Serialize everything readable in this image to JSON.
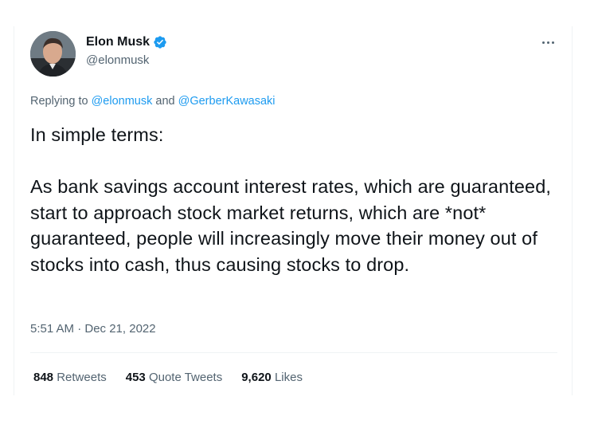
{
  "author": {
    "display_name": "Elon Musk",
    "handle": "@elonmusk",
    "verified": true,
    "verified_color": "#1d9bf0"
  },
  "reply": {
    "prefix": "Replying to ",
    "mention_1": "@elonmusk",
    "joiner": " and ",
    "mention_2": "@GerberKawasaki"
  },
  "tweet": {
    "text": "In simple terms:\n\nAs bank savings account interest rates, which are guaranteed, start to approach stock market returns, which are *not* guaranteed, people will increasingly move their money out of stocks into cash, thus causing stocks to drop.",
    "timestamp": "5:51 AM · Dec 21, 2022"
  },
  "stats": {
    "retweets": {
      "count": "848",
      "label": "Retweets"
    },
    "quote_tweets": {
      "count": "453",
      "label": "Quote Tweets"
    },
    "likes": {
      "count": "9,620",
      "label": "Likes"
    }
  },
  "icons": {
    "more": "more-horizontal-icon",
    "verified": "verified-badge-icon"
  },
  "colors": {
    "text": "#0f1419",
    "secondary": "#536471",
    "link": "#1d9bf0",
    "border": "#eff3f4"
  }
}
